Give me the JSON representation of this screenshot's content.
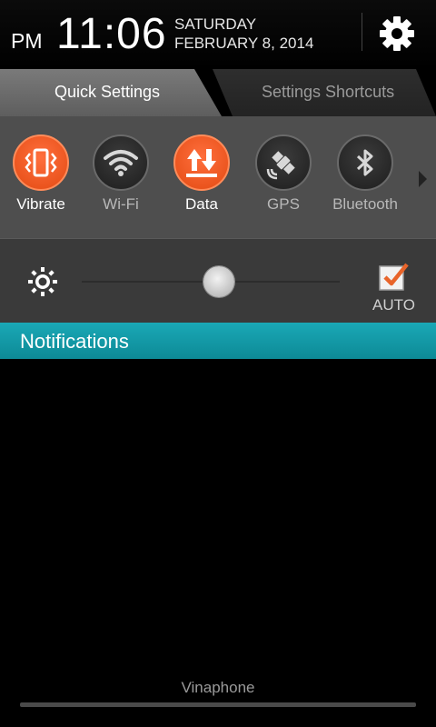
{
  "header": {
    "ampm": "PM",
    "time": "11:06",
    "day_of_week": "SATURDAY",
    "date": "FEBRUARY 8, 2014",
    "settings_icon": "gear-icon"
  },
  "tabs": [
    {
      "label": "Quick Settings",
      "active": true
    },
    {
      "label": "Settings Shortcuts",
      "active": false
    }
  ],
  "quick_settings": [
    {
      "label": "Vibrate",
      "icon": "vibrate-icon",
      "on": true
    },
    {
      "label": "Wi-Fi",
      "icon": "wifi-icon",
      "on": false
    },
    {
      "label": "Data",
      "icon": "data-icon",
      "on": true
    },
    {
      "label": "GPS",
      "icon": "gps-satellite-icon",
      "on": false
    },
    {
      "label": "Bluetooth",
      "icon": "bluetooth-icon",
      "on": false
    }
  ],
  "brightness": {
    "icon": "brightness-sun-icon",
    "level_fraction": 0.53,
    "auto_label": "AUTO",
    "auto_checked": true
  },
  "notifications": {
    "title": "Notifications"
  },
  "carrier": "Vinaphone",
  "colors": {
    "accent_orange": "#e9531c",
    "notif_teal": "#1199a6",
    "check_orange": "#e8642a"
  }
}
